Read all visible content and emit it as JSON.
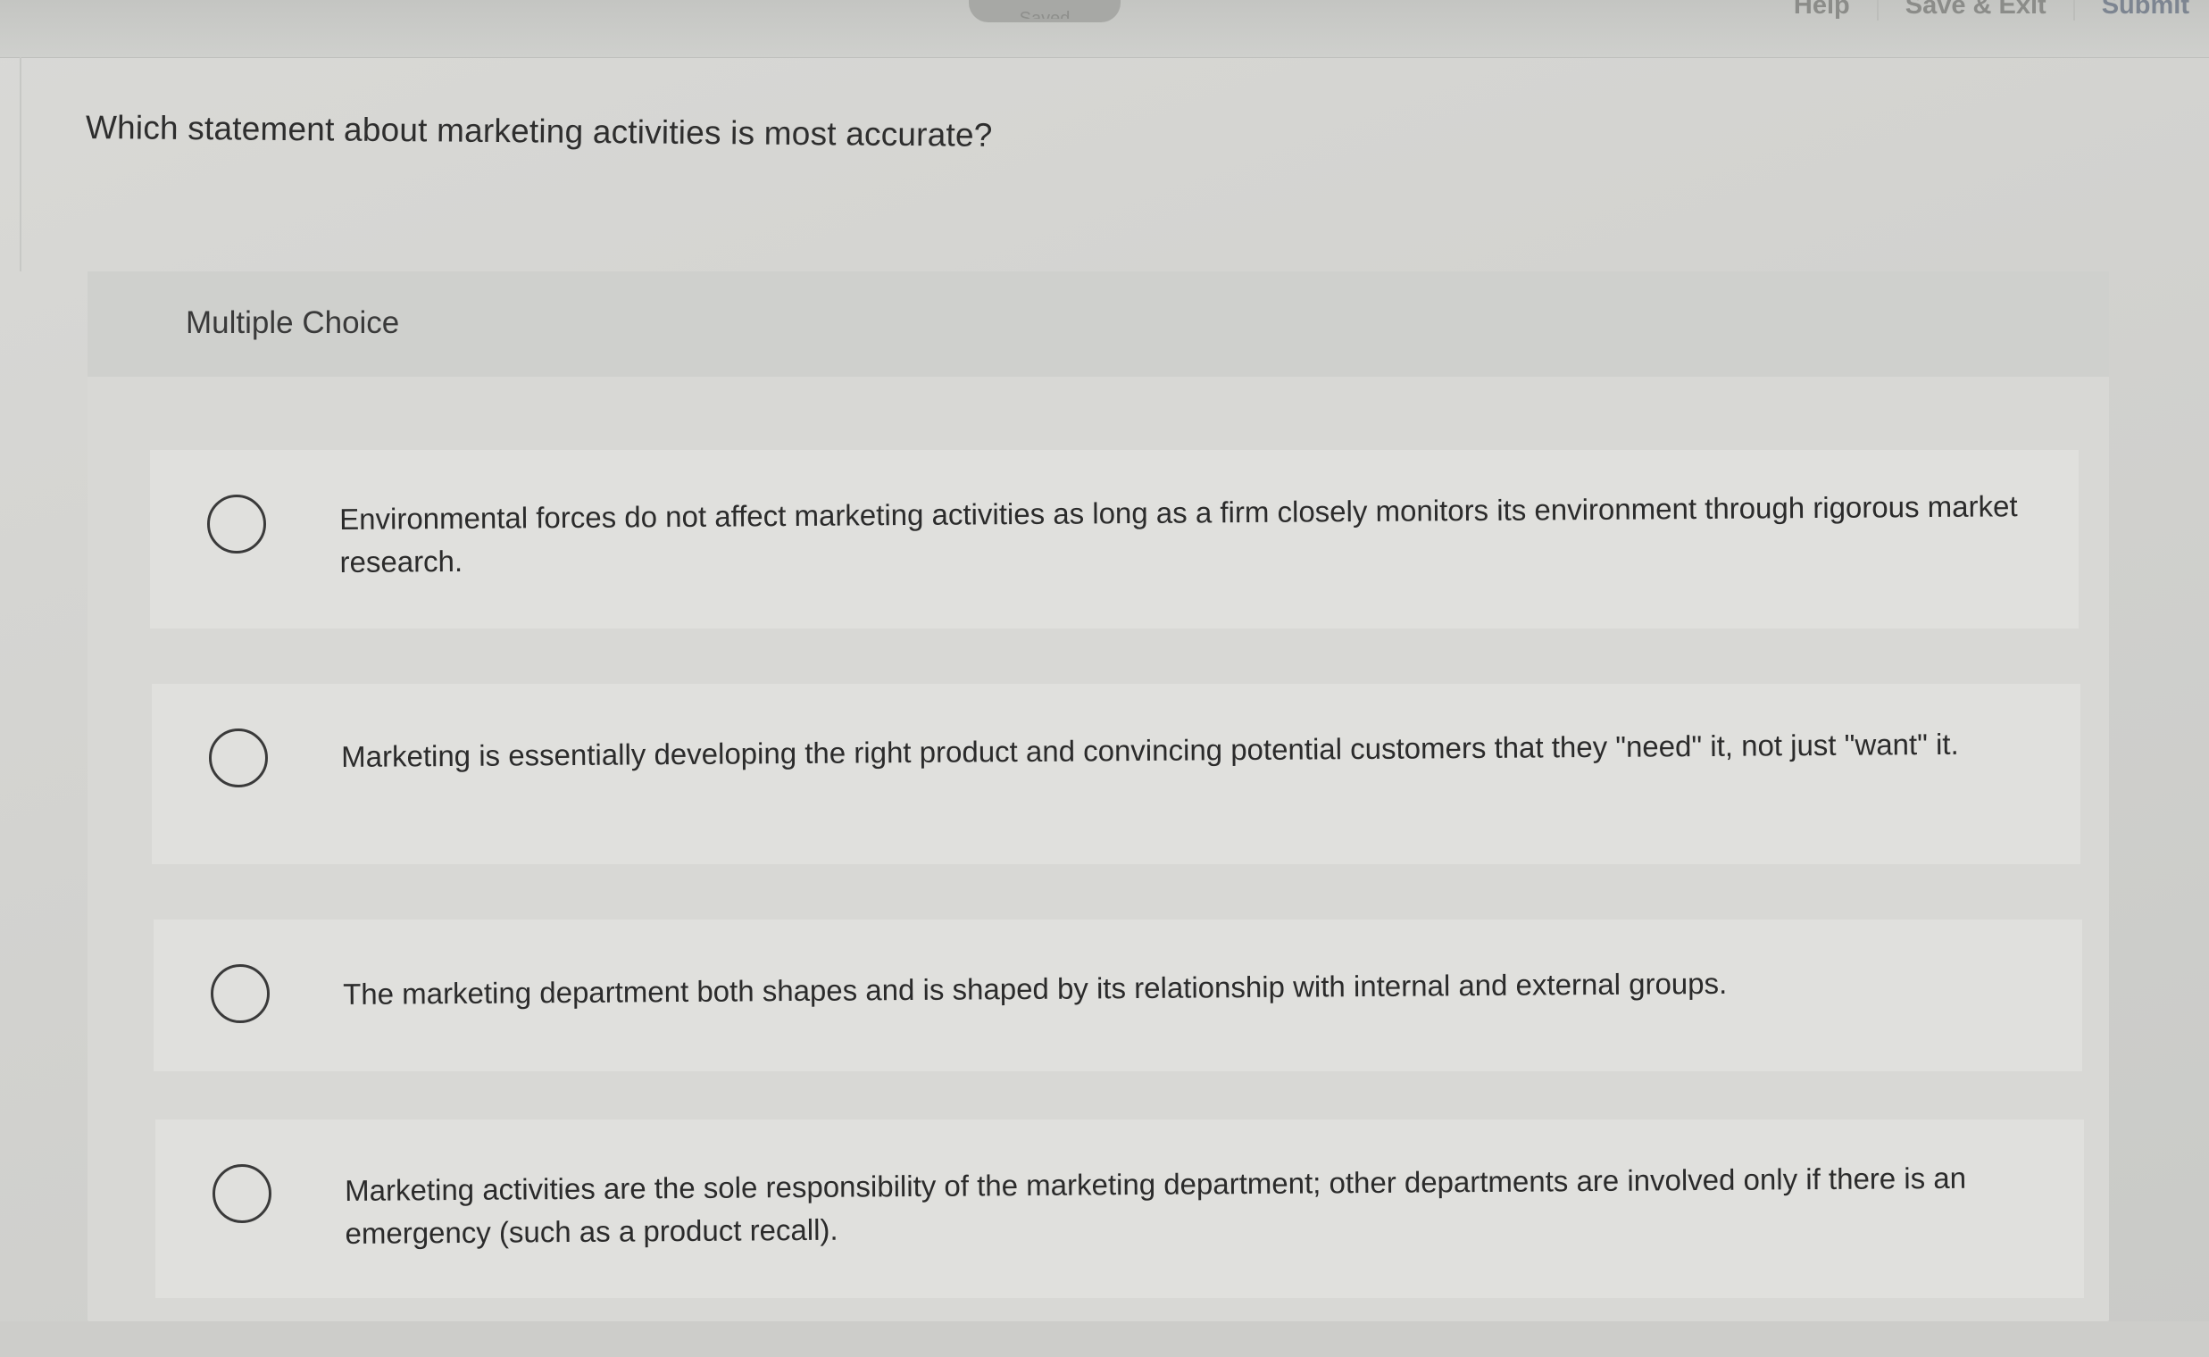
{
  "topbar": {
    "saved_label": "Saved",
    "help_label": "Help",
    "save_exit_label": "Save & Exit",
    "submit_label": "Submit"
  },
  "question": {
    "prompt": "Which statement about marketing activities is most accurate?"
  },
  "answer_panel": {
    "type_label": "Multiple Choice",
    "choices": [
      {
        "text": "Environmental forces do not affect marketing activities as long as a firm closely monitors its environment through rigorous market research.",
        "selected": false
      },
      {
        "text": "Marketing is essentially developing the right product and convincing potential customers that they \"need\" it, not just \"want\" it.",
        "selected": false
      },
      {
        "text": "The marketing department both shapes and is shaped by its relationship with internal and external groups.",
        "selected": false
      },
      {
        "text": "Marketing activities are the sole responsibility of the marketing department; other departments are involved only if there is an emergency (such as a product recall).",
        "selected": false
      }
    ]
  },
  "colors": {
    "background": "#d6d6d3",
    "panel": "#d8d8d5",
    "choice_card": "#e0e0dd",
    "text": "#2b2b2b",
    "submit_link": "#7d8591"
  }
}
